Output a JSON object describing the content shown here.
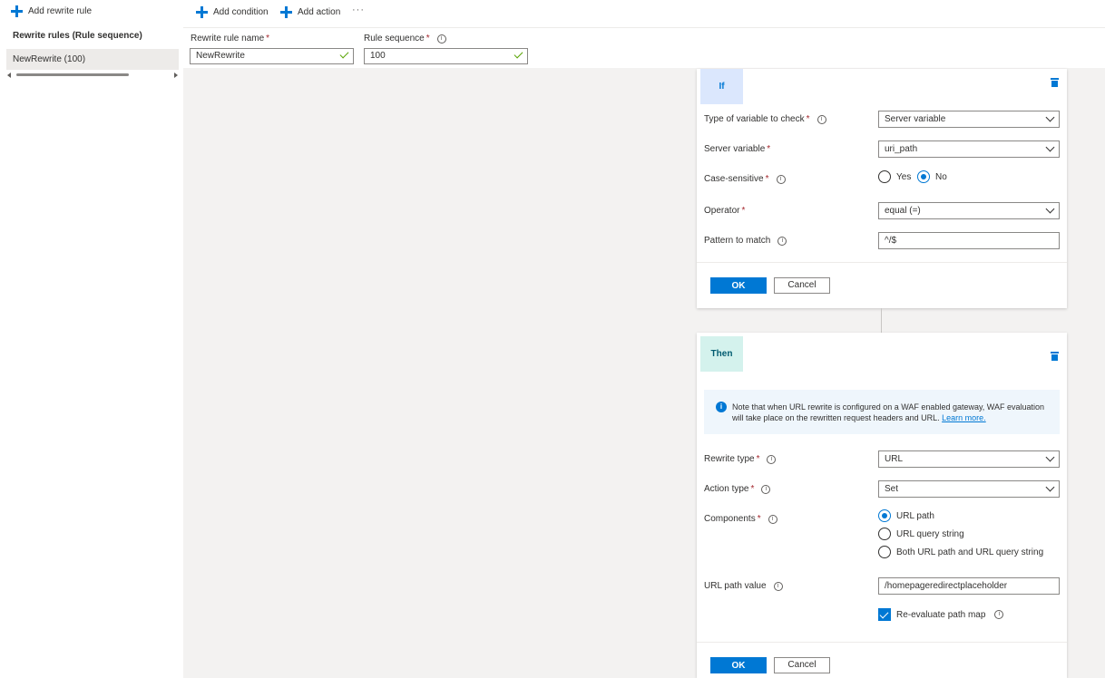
{
  "sidebar": {
    "add_rule_label": "Add rewrite rule",
    "title": "Rewrite rules (Rule sequence)",
    "items": [
      {
        "label": "NewRewrite (100)"
      }
    ]
  },
  "toolbar": {
    "add_condition_label": "Add condition",
    "add_action_label": "Add action",
    "more_label": "···"
  },
  "rule": {
    "name_label": "Rewrite rule name",
    "name_value": "NewRewrite",
    "sequence_label": "Rule sequence",
    "sequence_value": "100"
  },
  "condition": {
    "badge": "If",
    "type_label": "Type of variable to check",
    "type_value": "Server variable",
    "server_var_label": "Server variable",
    "server_var_value": "uri_path",
    "case_label": "Case-sensitive",
    "case_options": [
      "Yes",
      "No"
    ],
    "case_selected": "No",
    "operator_label": "Operator",
    "operator_value": "equal (=)",
    "pattern_label": "Pattern to match",
    "pattern_value": "^/$",
    "ok_label": "OK",
    "cancel_label": "Cancel"
  },
  "action": {
    "badge": "Then",
    "note_text": "Note that when URL rewrite is configured on a WAF enabled gateway, WAF evaluation will take place on the rewritten request headers and URL.",
    "note_link": "Learn more.",
    "rewrite_type_label": "Rewrite type",
    "rewrite_type_value": "URL",
    "action_type_label": "Action type",
    "action_type_value": "Set",
    "components_label": "Components",
    "components_options": [
      "URL path",
      "URL query string",
      "Both URL path and URL query string"
    ],
    "components_selected": "URL path",
    "url_path_label": "URL path value",
    "url_path_value": "/homepageredirectplaceholder",
    "reevaluate_label": "Re-evaluate path map",
    "reevaluate_checked": true,
    "ok_label": "OK",
    "cancel_label": "Cancel"
  },
  "colors": {
    "accent": "#0078d4",
    "if_badge_bg": "#dbe7fd",
    "then_badge_bg": "#d4f2ed",
    "required": "#a4262c",
    "valid_check": "#57a300"
  },
  "icons": [
    "plus-icon",
    "more-icon",
    "info-icon",
    "checkmark-icon",
    "chevron-down-icon",
    "trash-icon"
  ]
}
